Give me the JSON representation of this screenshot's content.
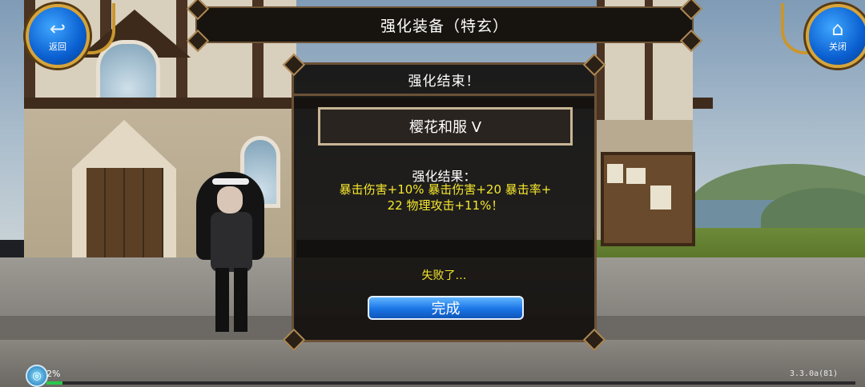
{
  "header": {
    "title": "强化装备（特玄）"
  },
  "nav": {
    "back_label": "返回",
    "back_icon": "return-arrow-icon",
    "close_label": "关闭",
    "close_icon": "home-icon"
  },
  "dialog": {
    "title": "强化结束！",
    "item_name": "樱花和服 V",
    "result_heading": "强化结果：",
    "result_lines": [
      "暴击伤害+10% 暴击伤害+20 暴击率+",
      "22 物理攻击+11%！"
    ],
    "status_text": "失败了…",
    "done_label": "完成"
  },
  "hud": {
    "exp_text": "2%",
    "exp_fraction": 0.02,
    "version": "3.3.0a(81)"
  },
  "colors": {
    "result_text": "#f6e72d",
    "button_blue": "#1b75e6",
    "frame_brown": "#6b5136",
    "gold_trim": "#d6a43a"
  }
}
